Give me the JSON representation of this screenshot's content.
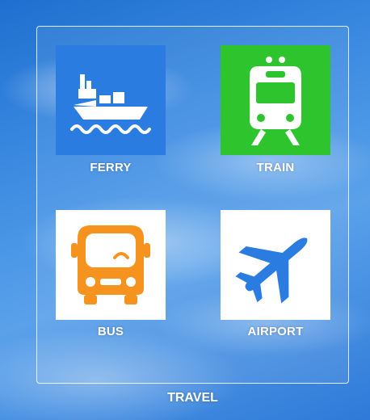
{
  "group": {
    "label": "TRAVEL"
  },
  "tiles": [
    {
      "label": "FERRY",
      "icon": "ferry-icon",
      "bg": "#2a7ce0",
      "fg": "#ffffff"
    },
    {
      "label": "TRAIN",
      "icon": "train-icon",
      "bg": "#2ec42e",
      "fg": "#ffffff"
    },
    {
      "label": "BUS",
      "icon": "bus-icon",
      "bg": "#ffffff",
      "fg": "#f6921e"
    },
    {
      "label": "AIRPORT",
      "icon": "airplane-icon",
      "bg": "#ffffff",
      "fg": "#2a7ce0"
    }
  ]
}
